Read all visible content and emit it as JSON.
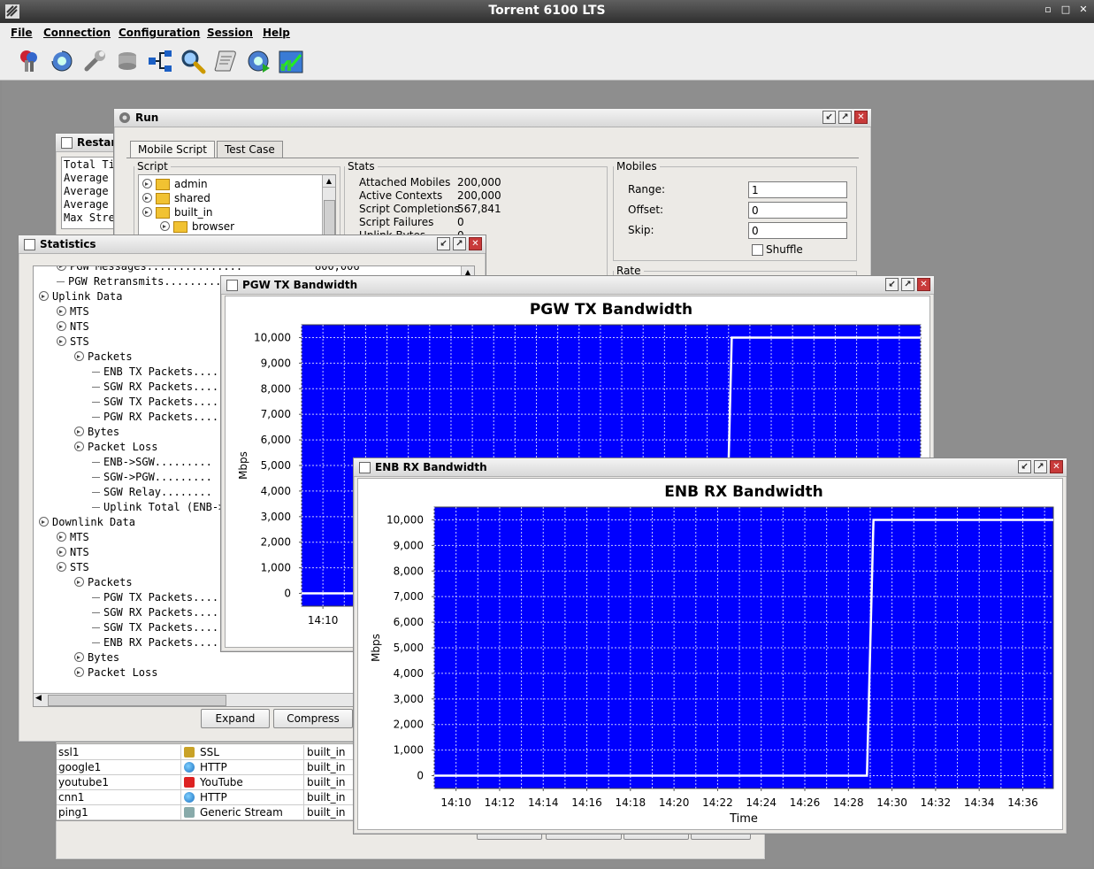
{
  "app": {
    "title": "Torrent 6100 LTS",
    "window_buttons": [
      "▫",
      "□",
      "✕"
    ]
  },
  "menu": [
    "File",
    "Connection",
    "Configuration",
    "Session",
    "Help"
  ],
  "toolbar_icons": [
    "keys-icon",
    "gear-refresh-icon",
    "wrench-icon",
    "database-icon",
    "network-icon",
    "magnifier-icon",
    "script-icon",
    "gear-play-icon",
    "chart-icon"
  ],
  "restart_window": {
    "title": "Restar",
    "lines": [
      "Total Ti",
      "Average",
      "Average",
      "Average",
      "Max Stre"
    ]
  },
  "run_window": {
    "title": "Run",
    "tabs": [
      "Mobile Script",
      "Test Case"
    ],
    "script_legend": "Script",
    "script_tree": [
      "admin",
      "shared",
      "built_in",
      "browser"
    ],
    "stats_legend": "Stats",
    "stats": [
      {
        "label": "Attached Mobiles",
        "value": "200,000"
      },
      {
        "label": "Active Contexts",
        "value": "200,000"
      },
      {
        "label": "Script Completions",
        "value": "567,841"
      },
      {
        "label": "Script Failures",
        "value": "0"
      },
      {
        "label": "Uplink Bytes",
        "value": "0"
      }
    ],
    "mobiles_legend": "Mobiles",
    "range_label": "Range:",
    "range_value": "1",
    "offset_label": "Offset:",
    "offset_value": "0",
    "skip_label": "Skip:",
    "skip_value": "0",
    "shuffle_label": "Shuffle",
    "rate_legend": "Rate"
  },
  "statistics_window": {
    "title": "Statistics",
    "rows": [
      {
        "indent": 1,
        "toggle": true,
        "text": "PGW Messages...............",
        "value": "800,006"
      },
      {
        "indent": 1,
        "toggle": false,
        "text": "PGW Retransmits............",
        "value": ""
      },
      {
        "indent": 0,
        "toggle": true,
        "text": "Uplink Data",
        "value": ""
      },
      {
        "indent": 1,
        "toggle": true,
        "text": "MTS",
        "value": ""
      },
      {
        "indent": 1,
        "toggle": true,
        "text": "NTS",
        "value": ""
      },
      {
        "indent": 1,
        "toggle": true,
        "text": "STS",
        "value": ""
      },
      {
        "indent": 2,
        "toggle": true,
        "text": "Packets",
        "value": ""
      },
      {
        "indent": 3,
        "toggle": false,
        "text": "ENB TX Packets.....",
        "value": ""
      },
      {
        "indent": 3,
        "toggle": false,
        "text": "SGW RX Packets.....",
        "value": ""
      },
      {
        "indent": 3,
        "toggle": false,
        "text": "SGW TX Packets.....",
        "value": ""
      },
      {
        "indent": 3,
        "toggle": false,
        "text": "PGW RX Packets.....",
        "value": ""
      },
      {
        "indent": 2,
        "toggle": true,
        "text": "Bytes",
        "value": ""
      },
      {
        "indent": 2,
        "toggle": true,
        "text": "Packet Loss",
        "value": ""
      },
      {
        "indent": 3,
        "toggle": false,
        "text": "ENB->SGW.........",
        "value": ""
      },
      {
        "indent": 3,
        "toggle": false,
        "text": "SGW->PGW.........",
        "value": ""
      },
      {
        "indent": 3,
        "toggle": false,
        "text": "SGW Relay........",
        "value": ""
      },
      {
        "indent": 3,
        "toggle": false,
        "text": "Uplink Total (ENB->",
        "value": ""
      },
      {
        "indent": 0,
        "toggle": true,
        "text": "Downlink Data",
        "value": ""
      },
      {
        "indent": 1,
        "toggle": true,
        "text": "MTS",
        "value": ""
      },
      {
        "indent": 1,
        "toggle": true,
        "text": "NTS",
        "value": ""
      },
      {
        "indent": 1,
        "toggle": true,
        "text": "STS",
        "value": ""
      },
      {
        "indent": 2,
        "toggle": true,
        "text": "Packets",
        "value": ""
      },
      {
        "indent": 3,
        "toggle": false,
        "text": "PGW TX Packets.....",
        "value": ""
      },
      {
        "indent": 3,
        "toggle": false,
        "text": "SGW RX Packets.....",
        "value": ""
      },
      {
        "indent": 3,
        "toggle": false,
        "text": "SGW TX Packets.....",
        "value": ""
      },
      {
        "indent": 3,
        "toggle": false,
        "text": "ENB RX Packets.....",
        "value": ""
      },
      {
        "indent": 2,
        "toggle": true,
        "text": "Bytes",
        "value": ""
      },
      {
        "indent": 2,
        "toggle": true,
        "text": "Packet Loss",
        "value": ""
      }
    ],
    "expand_label": "Expand",
    "compress_label": "Compress"
  },
  "script_table": [
    {
      "name": "ssl1",
      "protocol": "SSL",
      "icon": "lock-icon",
      "source": "built_in"
    },
    {
      "name": "google1",
      "protocol": "HTTP",
      "icon": "globe-icon",
      "source": "built_in"
    },
    {
      "name": "youtube1",
      "protocol": "YouTube",
      "icon": "youtube-icon",
      "source": "built_in"
    },
    {
      "name": "cnn1",
      "protocol": "HTTP",
      "icon": "globe-icon",
      "source": "built_in"
    },
    {
      "name": "ping1",
      "protocol": "Generic Stream",
      "icon": "stream-icon",
      "source": "built_in"
    }
  ],
  "chart_data": [
    {
      "window_title": "PGW TX Bandwidth",
      "type": "line",
      "title": "PGW TX Bandwidth",
      "ylabel": "Mbps",
      "xlabel": "",
      "ylim": [
        -500,
        10500
      ],
      "yticks": [
        0,
        1000,
        2000,
        3000,
        4000,
        5000,
        6000,
        7000,
        8000,
        9000,
        10000
      ],
      "ytick_labels": [
        "0",
        "1,000",
        "2,000",
        "3,000",
        "4,000",
        "5,000",
        "6,000",
        "7,000",
        "8,000",
        "9,000",
        "10,000"
      ],
      "xlim": [
        9.0,
        38.0
      ],
      "xticks": [
        10
      ],
      "xtick_labels": [
        "14:10"
      ],
      "grid": true,
      "background": "#0000ff",
      "line_color": "#ffffff",
      "series": [
        {
          "x": [
            9.0,
            28.85,
            29.15,
            38.0
          ],
          "y": [
            0,
            0,
            10000,
            10000
          ]
        }
      ]
    },
    {
      "window_title": "ENB RX Bandwidth",
      "type": "line",
      "title": "ENB RX Bandwidth",
      "ylabel": "Mbps",
      "xlabel": "Time",
      "ylim": [
        -500,
        10500
      ],
      "yticks": [
        0,
        1000,
        2000,
        3000,
        4000,
        5000,
        6000,
        7000,
        8000,
        9000,
        10000
      ],
      "ytick_labels": [
        "0",
        "1,000",
        "2,000",
        "3,000",
        "4,000",
        "5,000",
        "6,000",
        "7,000",
        "8,000",
        "9,000",
        "10,000"
      ],
      "xlim": [
        9.0,
        37.4
      ],
      "xticks": [
        10,
        12,
        14,
        16,
        18,
        20,
        22,
        24,
        26,
        28,
        30,
        32,
        34,
        36
      ],
      "xtick_labels": [
        "14:10",
        "14:12",
        "14:14",
        "14:16",
        "14:18",
        "14:20",
        "14:22",
        "14:24",
        "14:26",
        "14:28",
        "14:30",
        "14:32",
        "14:34",
        "14:36"
      ],
      "grid": true,
      "background": "#0000ff",
      "line_color": "#ffffff",
      "series": [
        {
          "x": [
            9.0,
            28.85,
            29.15,
            37.4
          ],
          "y": [
            0,
            0,
            10000,
            10000
          ]
        }
      ]
    }
  ]
}
